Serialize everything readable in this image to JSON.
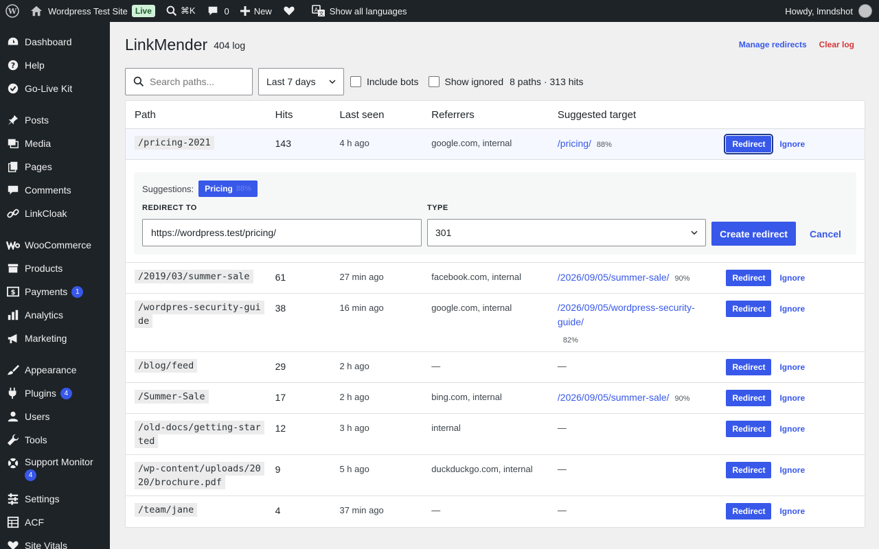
{
  "adminbar": {
    "site_name": "Wordpress Test Site",
    "live_badge": "Live",
    "shortcut": "⌘K",
    "comments_count": "0",
    "new_label": "New",
    "languages_label": "Show all languages",
    "howdy": "Howdy, lmndshot"
  },
  "sidebar": {
    "items": [
      {
        "label": "Dashboard"
      },
      {
        "label": "Help"
      },
      {
        "label": "Go-Live Kit"
      },
      {
        "label": "Posts"
      },
      {
        "label": "Media"
      },
      {
        "label": "Pages"
      },
      {
        "label": "Comments"
      },
      {
        "label": "LinkCloak"
      },
      {
        "label": "WooCommerce"
      },
      {
        "label": "Products"
      },
      {
        "label": "Payments",
        "badge": "1"
      },
      {
        "label": "Analytics"
      },
      {
        "label": "Marketing"
      },
      {
        "label": "Appearance"
      },
      {
        "label": "Plugins",
        "badge": "4"
      },
      {
        "label": "Users"
      },
      {
        "label": "Tools"
      },
      {
        "label": "Support Monitor",
        "badge": "4"
      },
      {
        "label": "Settings"
      },
      {
        "label": "ACF"
      },
      {
        "label": "Site Vitals"
      }
    ]
  },
  "header": {
    "title": "LinkMender",
    "subtitle": "404 log",
    "manage_redirects": "Manage redirects",
    "clear_log": "Clear log"
  },
  "filters": {
    "search_placeholder": "Search paths...",
    "range_value": "Last 7 days",
    "include_bots": "Include bots",
    "show_ignored": "Show ignored",
    "summary": "8 paths · 313 hits"
  },
  "table": {
    "headers": {
      "path": "Path",
      "hits": "Hits",
      "last_seen": "Last seen",
      "referrers": "Referrers",
      "suggested": "Suggested target"
    },
    "redirect_label": "Redirect",
    "ignore_label": "Ignore",
    "rows": [
      {
        "path": "/pricing-2021",
        "hits": "143",
        "last_seen": "4 h ago",
        "referrers": "google.com, internal",
        "target": "/pricing/",
        "pct": "88%"
      },
      {
        "path": "/2019/03/summer-sale",
        "hits": "61",
        "last_seen": "27 min ago",
        "referrers": "facebook.com, internal",
        "target": "/2026/09/05/summer-sale/",
        "pct": "90%"
      },
      {
        "path": "/wordpres-security-guide",
        "hits": "38",
        "last_seen": "16 min ago",
        "referrers": "google.com, internal",
        "target": "/2026/09/05/wordpress-security-guide/",
        "pct": "82%"
      },
      {
        "path": "/blog/feed",
        "hits": "29",
        "last_seen": "2 h ago",
        "referrers": "—",
        "target": "—",
        "pct": ""
      },
      {
        "path": "/Summer-Sale",
        "hits": "17",
        "last_seen": "2 h ago",
        "referrers": "bing.com, internal",
        "target": "/2026/09/05/summer-sale/",
        "pct": "90%"
      },
      {
        "path": "/old-docs/getting-started",
        "hits": "12",
        "last_seen": "3 h ago",
        "referrers": "internal",
        "target": "—",
        "pct": ""
      },
      {
        "path": "/wp-content/uploads/2020/brochure.pdf",
        "hits": "9",
        "last_seen": "5 h ago",
        "referrers": "duckduckgo.com, internal",
        "target": "—",
        "pct": ""
      },
      {
        "path": "/team/jane",
        "hits": "4",
        "last_seen": "37 min ago",
        "referrers": "—",
        "target": "—",
        "pct": ""
      }
    ]
  },
  "panel": {
    "suggestions_label": "Suggestions:",
    "chip_label": "Pricing",
    "chip_pct": "88%",
    "redirect_to_label": "REDIRECT TO",
    "redirect_to_value": "https://wordpress.test/pricing/",
    "type_label": "TYPE",
    "type_value": "301",
    "create_label": "Create redirect",
    "cancel_label": "Cancel"
  },
  "colors": {
    "accent": "#3858e9",
    "danger": "#d63638",
    "sidebar_bg": "#1d2327"
  }
}
